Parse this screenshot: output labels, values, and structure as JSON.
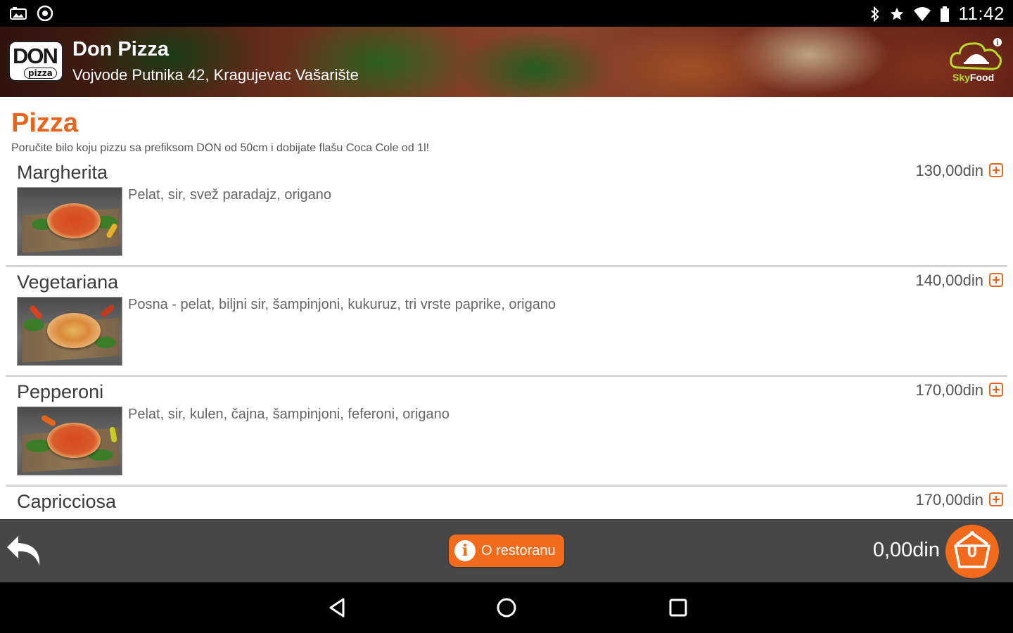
{
  "status_bar": {
    "time": "11:42",
    "left_icons": [
      "photo-icon",
      "sync-icon"
    ],
    "right_icons": [
      "bluetooth-icon",
      "star-icon",
      "wifi-icon",
      "battery-icon"
    ]
  },
  "header": {
    "logo_text": "DON",
    "logo_sub": "pizza",
    "restaurant_name": "Don Pizza",
    "address": "Vojvode Putnika 42, Kragujevac Vašarište",
    "brand_logo": {
      "prefix": "Sky",
      "suffix": "Food"
    },
    "accent_color": "#e8641a"
  },
  "category": {
    "title": "Pizza",
    "promo": "Poručite bilo koju pizzu sa prefiksom DON od 50cm i dobijate flašu Coca Cole od 1l!"
  },
  "menu_items": [
    {
      "name": "Margherita",
      "price": "130,00din",
      "description": "Pelat, sir, svež paradajz, origano"
    },
    {
      "name": "Vegetariana",
      "price": "140,00din",
      "description": "Posna - pelat, biljni sir, šampinjoni, kukuruz, tri vrste paprike, origano"
    },
    {
      "name": "Pepperoni",
      "price": "170,00din",
      "description": "Pelat, sir, kulen, čajna, šampinjoni, feferoni, origano"
    },
    {
      "name": "Capricciosa",
      "price": "170,00din",
      "description": ""
    }
  ],
  "bottom_bar": {
    "about_label": "O restoranu",
    "cart_total": "0,00din",
    "cart_count": "0",
    "button_color": "#f26a1b"
  },
  "nav_bar": {
    "buttons": [
      "back-triangle-icon",
      "home-circle-icon",
      "recents-square-icon"
    ]
  }
}
